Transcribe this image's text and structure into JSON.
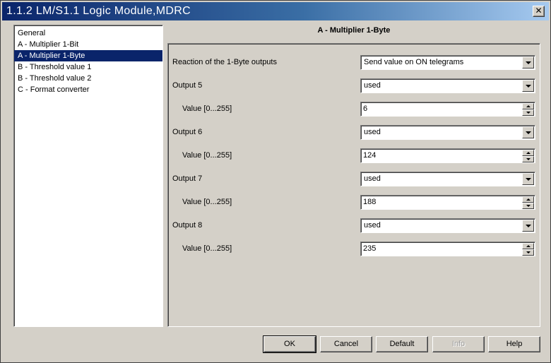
{
  "window": {
    "title": "1.1.2 LM/S1.1 Logic Module,MDRC",
    "close_glyph": "✕"
  },
  "tree": {
    "items": [
      {
        "label": "General",
        "selected": false
      },
      {
        "label": "A - Multiplier 1-Bit",
        "selected": false
      },
      {
        "label": "A - Multiplier 1-Byte",
        "selected": true
      },
      {
        "label": "B - Threshold value 1",
        "selected": false
      },
      {
        "label": "B - Threshold value 2",
        "selected": false
      },
      {
        "label": "C - Format converter",
        "selected": false
      }
    ]
  },
  "page": {
    "title": "A - Multiplier 1-Byte",
    "params": [
      {
        "label": "Reaction of the 1-Byte outputs",
        "indent": 1,
        "control": "dropdown",
        "value": "Send value on ON telegrams"
      },
      {
        "label": "Output 5",
        "indent": 1,
        "control": "dropdown",
        "value": "used"
      },
      {
        "label": "Value [0...255]",
        "indent": 2,
        "control": "spin",
        "value": "6"
      },
      {
        "label": "Output 6",
        "indent": 1,
        "control": "dropdown",
        "value": "used"
      },
      {
        "label": "Value [0...255]",
        "indent": 2,
        "control": "spin",
        "value": "124"
      },
      {
        "label": "Output 7",
        "indent": 1,
        "control": "dropdown",
        "value": "used"
      },
      {
        "label": "Value [0...255]",
        "indent": 2,
        "control": "spin",
        "value": "188"
      },
      {
        "label": "Output 8",
        "indent": 1,
        "control": "dropdown",
        "value": "used"
      },
      {
        "label": "Value [0...255]",
        "indent": 2,
        "control": "spin",
        "value": "235"
      }
    ]
  },
  "buttons": {
    "ok": "OK",
    "cancel": "Cancel",
    "default": "Default",
    "info": "Info",
    "help": "Help"
  },
  "colors": {
    "title_bar_start": "#0a246a",
    "title_bar_end": "#a6caf0",
    "selection": "#0a246a",
    "face": "#d4d0c8"
  }
}
